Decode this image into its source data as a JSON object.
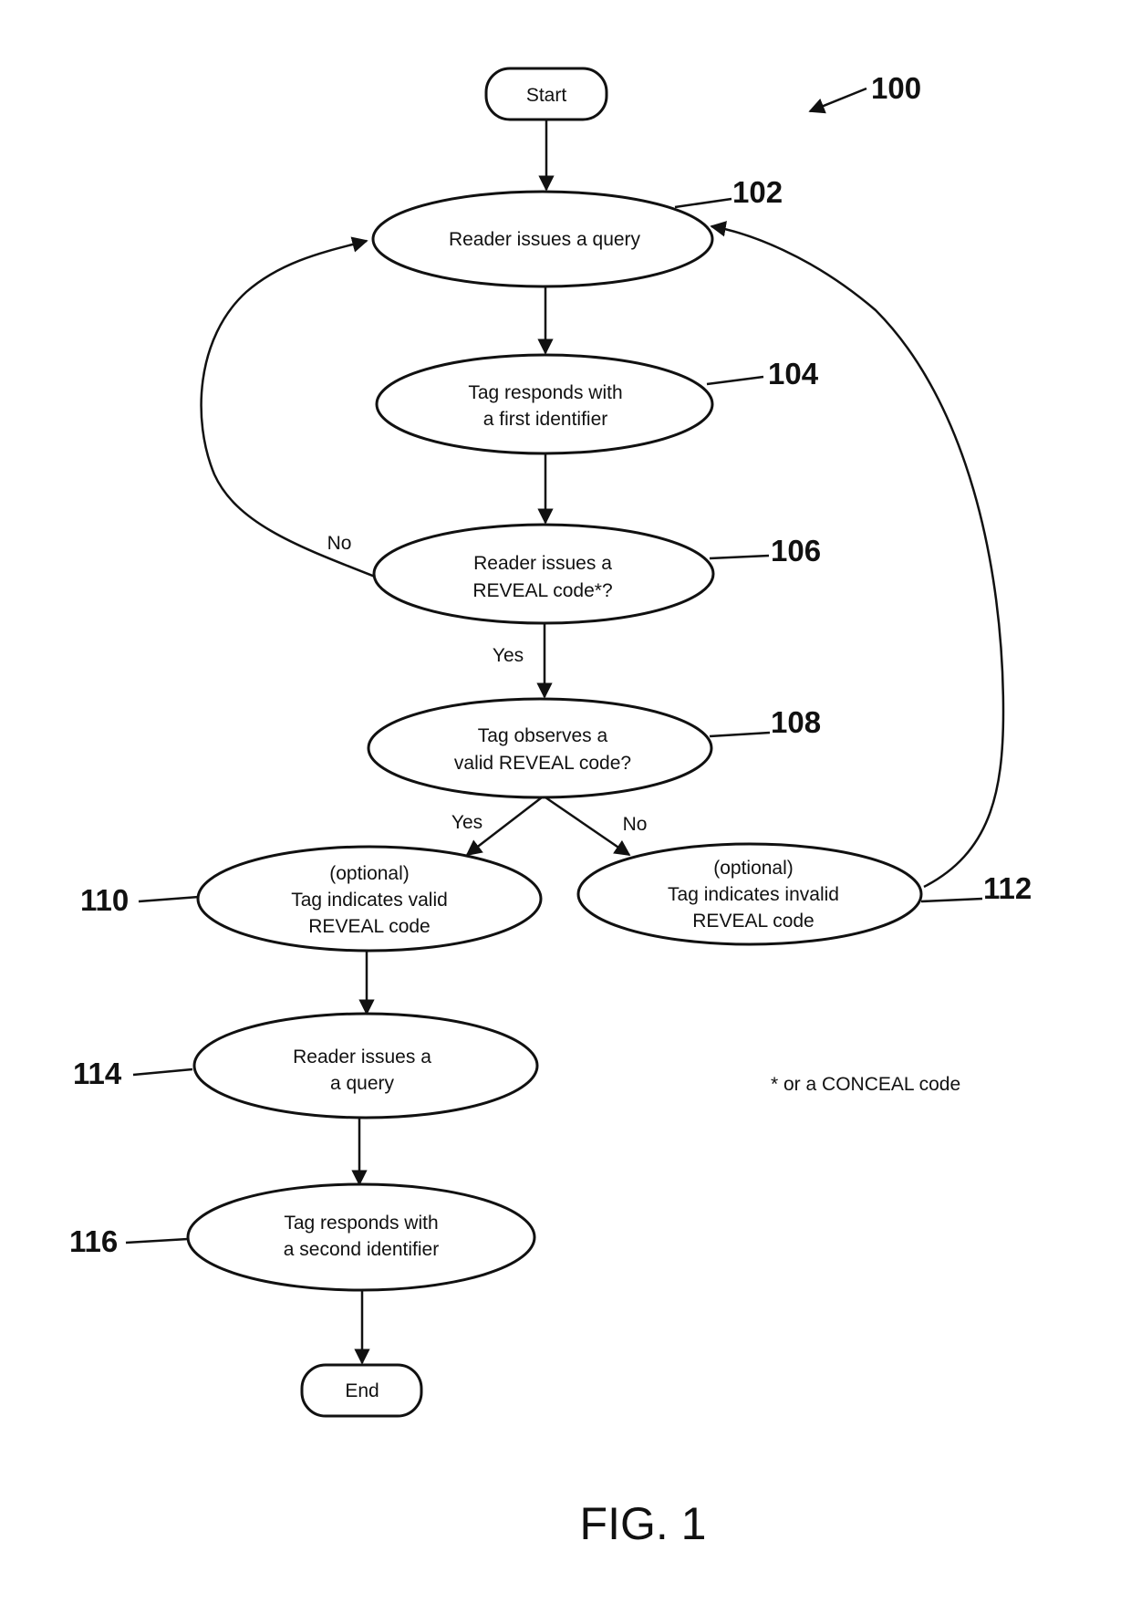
{
  "figure": {
    "reference": "100",
    "caption": "FIG. 1",
    "footnote": "* or a CONCEAL code"
  },
  "nodes": {
    "start": {
      "type": "terminal",
      "lines": [
        "Start"
      ]
    },
    "n102": {
      "type": "process",
      "ref": "102",
      "lines": [
        "Reader issues a query"
      ]
    },
    "n104": {
      "type": "process",
      "ref": "104",
      "lines": [
        "Tag responds with",
        "a first identifier"
      ]
    },
    "n106": {
      "type": "decision",
      "ref": "106",
      "lines": [
        "Reader issues a",
        "REVEAL code*?"
      ]
    },
    "n108": {
      "type": "decision",
      "ref": "108",
      "lines": [
        "Tag observes a",
        "valid REVEAL code?"
      ]
    },
    "n110": {
      "type": "process",
      "ref": "110",
      "lines": [
        "(optional)",
        "Tag indicates valid",
        "REVEAL code"
      ]
    },
    "n112": {
      "type": "process",
      "ref": "112",
      "lines": [
        "(optional)",
        "Tag indicates invalid",
        "REVEAL code"
      ]
    },
    "n114": {
      "type": "process",
      "ref": "114",
      "lines": [
        "Reader issues a",
        "a query"
      ]
    },
    "n116": {
      "type": "process",
      "ref": "116",
      "lines": [
        "Tag responds with",
        "a second identifier"
      ]
    },
    "end": {
      "type": "terminal",
      "lines": [
        "End"
      ]
    }
  },
  "edges": [
    {
      "from": "start",
      "to": "n102",
      "label": ""
    },
    {
      "from": "n102",
      "to": "n104",
      "label": ""
    },
    {
      "from": "n104",
      "to": "n106",
      "label": ""
    },
    {
      "from": "n106",
      "to": "n102",
      "label": "No"
    },
    {
      "from": "n106",
      "to": "n108",
      "label": "Yes"
    },
    {
      "from": "n108",
      "to": "n110",
      "label": "Yes"
    },
    {
      "from": "n108",
      "to": "n112",
      "label": "No"
    },
    {
      "from": "n112",
      "to": "n102",
      "label": ""
    },
    {
      "from": "n110",
      "to": "n114",
      "label": ""
    },
    {
      "from": "n114",
      "to": "n116",
      "label": ""
    },
    {
      "from": "n116",
      "to": "end",
      "label": ""
    }
  ]
}
